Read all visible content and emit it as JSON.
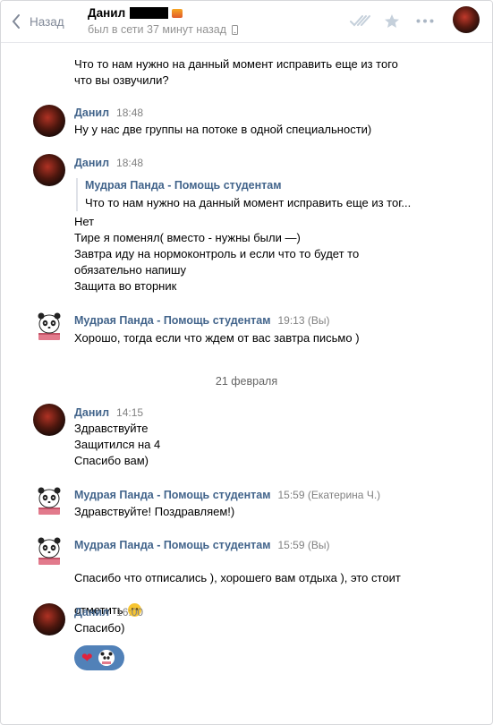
{
  "header": {
    "back_label": "Назад",
    "chat_name": "Данил",
    "status": "был в сети 37 минут назад"
  },
  "messages": {
    "m0_text": "Что то нам нужно на данный момент исправить еще из того\nчто вы озвучили?",
    "m1_author": "Данил",
    "m1_time": "18:48",
    "m1_text": "Ну у нас две группы на потоке в одной специальности)",
    "m2_author": "Данил",
    "m2_time": "18:48",
    "m2_quote_author": "Мудрая Панда - Помощь студентам",
    "m2_quote_text": "Что то нам нужно на данный момент исправить еще из тог...",
    "m2_text": "Нет\nТире я поменял( вместо - нужны были —)\nЗавтра иду на нормоконтроль и если что то будет то\nобязательно напишу\nЗащита во вторник",
    "m3_author": "Мудрая Панда - Помощь студентам",
    "m3_meta": "19:13 (Вы)",
    "m3_text": "Хорошо, тогда если что ждем от вас завтра письмо )",
    "date_separator": "21 февраля",
    "m4_author": "Данил",
    "m4_time": "14:15",
    "m4_text": "Здравствуйте\nЗащитился на 4\nСпасибо вам)",
    "m5_author": "Мудрая Панда - Помощь студентам",
    "m5_meta": "15:59 (Екатерина Ч.)",
    "m5_text": "Здравствуйте! Поздравляем!)",
    "m6_author": "Мудрая Панда - Помощь студентам",
    "m6_meta": "15:59 (Вы)",
    "m6_text_line1": "Спасибо что отписались ), хорошего вам отдыха ), это стоит",
    "m6_text_line2": "отметить",
    "m7_author": "Данил",
    "m7_time": "16:00",
    "m7_text": "Спасибо)"
  },
  "icons": {
    "back": "chevron-left-icon",
    "read": "double-check-icon",
    "favorite": "star-icon",
    "more": "more-dots-icon",
    "phone": "mobile-phone-icon",
    "reaction_1": "heart-icon",
    "reaction_2": "panda-icon"
  },
  "colors": {
    "link": "#42648b",
    "muted": "#828282",
    "reaction_bg": "#5181b8"
  }
}
